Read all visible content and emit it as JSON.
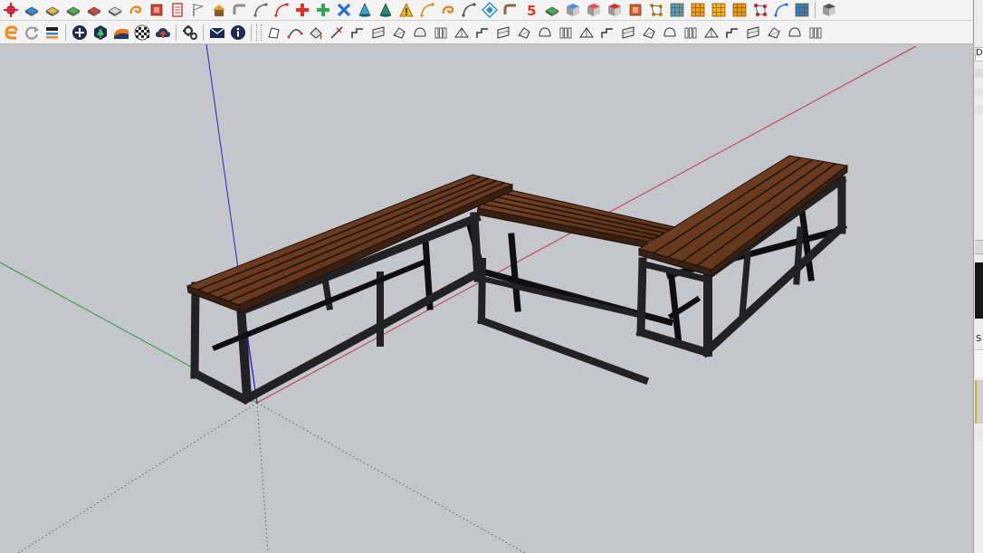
{
  "toolbar_top": {
    "buttons": [
      {
        "name": "gear-plugin-icon",
        "kind": "gear",
        "color": "#cc2233"
      },
      {
        "name": "push-pull-blue-icon",
        "kind": "slab",
        "color": "#2a8fd4"
      },
      {
        "name": "slab-yellow-icon",
        "kind": "slab",
        "color": "#e9b84a"
      },
      {
        "name": "slab-green-icon",
        "kind": "slab",
        "color": "#4fb34d"
      },
      {
        "name": "slab-red-icon",
        "kind": "slab",
        "color": "#d9473b"
      },
      {
        "name": "eraser-icon",
        "kind": "slab",
        "color": "#d8d8d8"
      },
      {
        "name": "follow-me-icon",
        "kind": "swirl",
        "color": "#e88a1e"
      },
      {
        "name": "shape-bender-icon",
        "kind": "square",
        "color": "#e23b2f"
      },
      {
        "name": "page-icon",
        "kind": "doc",
        "color": "#d63b3b"
      },
      {
        "name": "flag-icon",
        "kind": "flag",
        "color": "#777777"
      },
      {
        "name": "house-icon",
        "kind": "house",
        "color": "#e09a2b"
      },
      {
        "name": "pipe-icon",
        "kind": "pipe",
        "color": "#8f8f8f"
      },
      {
        "name": "curve-icon",
        "kind": "curve",
        "color": "#666666"
      },
      {
        "name": "bezier-icon",
        "kind": "curve",
        "color": "#d62f2f"
      },
      {
        "name": "cross-red-icon",
        "kind": "cross",
        "color": "#e0302a"
      },
      {
        "name": "cross-green-icon",
        "kind": "cross",
        "color": "#2fa84f"
      },
      {
        "name": "twist-icon",
        "kind": "twist",
        "color": "#2a6fd4"
      },
      {
        "name": "cone-icon",
        "kind": "cone",
        "color": "#3aa6c8"
      },
      {
        "name": "lathe-icon",
        "kind": "cone",
        "color": "#2f8f64"
      },
      {
        "name": "warning-icon",
        "kind": "triangle",
        "color": "#f2b619"
      },
      {
        "name": "arc-icon",
        "kind": "curve",
        "color": "#e08a1c"
      },
      {
        "name": "hook-icon",
        "kind": "swirl",
        "color": "#e0841e"
      },
      {
        "name": "spring-icon",
        "kind": "curve",
        "color": "#555555"
      },
      {
        "name": "diamond-icon",
        "kind": "diamond",
        "color": "#2a90d0"
      },
      {
        "name": "tube-icon",
        "kind": "pipe",
        "color": "#8a6a48"
      },
      {
        "name": "number-five-icon",
        "kind": "five",
        "color": "#e2341f"
      },
      {
        "name": "flatten-icon",
        "kind": "slab",
        "color": "#3db14b"
      },
      {
        "name": "box-stack-icon",
        "kind": "cube",
        "color": "#4f8fd8"
      },
      {
        "name": "box-red-icon",
        "kind": "cube",
        "color": "#e05050"
      },
      {
        "name": "box-multi-icon",
        "kind": "cube",
        "color": "#cc3333"
      },
      {
        "name": "tile-icon",
        "kind": "square",
        "color": "#e65a20"
      },
      {
        "name": "nodes-icon",
        "kind": "nodes",
        "color": "#d99a20"
      },
      {
        "name": "mesh-icon",
        "kind": "grid",
        "color": "#4aa0c8"
      },
      {
        "name": "grid-orange-icon",
        "kind": "grid",
        "color": "#f0a020"
      },
      {
        "name": "grid-yellow-icon",
        "kind": "grid",
        "color": "#f4b520"
      },
      {
        "name": "grid-amber-icon",
        "kind": "grid",
        "color": "#ea9a18"
      },
      {
        "name": "vertex-icon",
        "kind": "nodes",
        "color": "#e03030"
      },
      {
        "name": "path-icon",
        "kind": "curve",
        "color": "#2f6fd0"
      },
      {
        "name": "cube-grid-icon",
        "kind": "grid",
        "color": "#2f7fd0"
      }
    ],
    "tail": [
      {
        "name": "layers-icon",
        "kind": "cube",
        "color": "#555555"
      }
    ]
  },
  "toolbar_bottom": {
    "left_buttons": [
      {
        "name": "extension-e-icon",
        "kind": "letter-e",
        "color": "#f08a1c"
      },
      {
        "name": "refresh-icon",
        "kind": "refresh",
        "color": "#999999"
      },
      {
        "name": "import-icon",
        "kind": "import",
        "color": "#3a7fd8"
      }
    ],
    "mid_buttons": [
      {
        "name": "add-location-icon",
        "kind": "circle-plus",
        "color": "#1f2a55"
      },
      {
        "name": "add-tree-icon",
        "kind": "hex-tree",
        "color": "#1f2a55"
      },
      {
        "name": "terrain-icon",
        "kind": "terrain",
        "color": "#e6781e"
      },
      {
        "name": "checker-icon",
        "kind": "checker",
        "color": "#222222"
      },
      {
        "name": "cloud-upload-icon",
        "kind": "cloud",
        "color": "#d84a2a"
      }
    ],
    "settings_buttons": [
      {
        "name": "gears-icon",
        "kind": "gears",
        "color": "#333333"
      }
    ],
    "info_buttons": [
      {
        "name": "mail-icon",
        "kind": "mail",
        "color": "#1f2a55"
      },
      {
        "name": "info-icon",
        "kind": "info",
        "color": "#1f2a55"
      }
    ],
    "tool_buttons": [
      "nodes-outline-icon",
      "bezier-outline-icon",
      "paint-bucket-icon",
      "knife-icon",
      "lasso-icon",
      "cloud-outline-icon",
      "hook-outline-icon",
      "box-outline-icon",
      "sphere-icon",
      "slice-icon",
      "corner-icon",
      "angle-icon",
      "measure-icon",
      "fillet-icon",
      "cone-outline-icon",
      "columns-icon",
      "cylinder-icon",
      "dome-icon",
      "plane-icon",
      "tilt-icon",
      "stairs-icon",
      "ramp-icon",
      "fan-icon",
      "split-icon",
      "roof-icon",
      "pyramid-icon",
      "blocks-icon"
    ]
  },
  "right_panel": {
    "letters": [
      "D",
      "S"
    ]
  },
  "scene": {
    "background": "#c4c6cb",
    "axis_colors": {
      "red": "#c23a4a",
      "green": "#2f9a46",
      "blue": "#2727c9",
      "dashed": "#5a5a5a"
    },
    "wood_color": "#6a3a20",
    "wood_gap_color": "#1e140e",
    "frame_color": "#222226",
    "frame_dark": "#0f0f12"
  }
}
